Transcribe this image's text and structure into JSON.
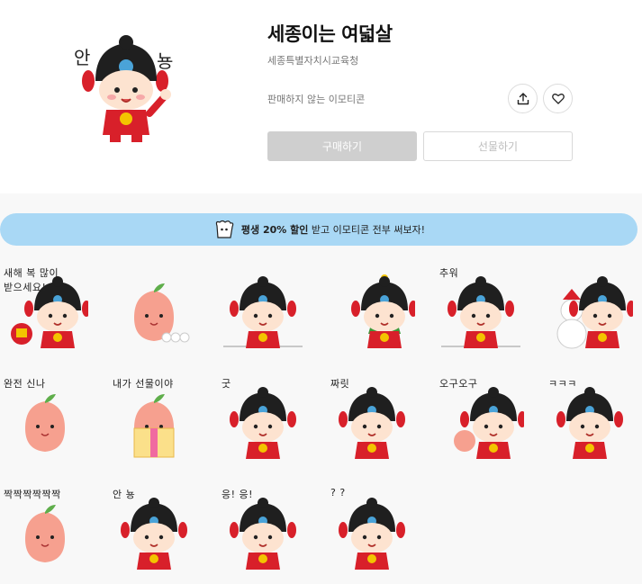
{
  "product": {
    "title": "세종이는 여덟살",
    "author": "세종특별자치시교육청",
    "status": "판매하지 않는 이모티콘",
    "hero_text_left": "안",
    "hero_text_right": "뇽"
  },
  "actions": {
    "share_icon": "share-icon",
    "like_icon": "heart-icon",
    "buy_label": "구매하기",
    "gift_label": "선물하기"
  },
  "banner": {
    "bold": "평생 20% 할인",
    "rest": " 받고 이모티콘 전부 써보자!"
  },
  "stickers": [
    {
      "caption": "새해 복 많이\n받으세요!",
      "kind": "boy-gift"
    },
    {
      "caption": "",
      "kind": "peach-snow"
    },
    {
      "caption": "",
      "kind": "boy-snow"
    },
    {
      "caption": "",
      "kind": "boy-tree"
    },
    {
      "caption": "추워",
      "kind": "boy-cold"
    },
    {
      "caption": "",
      "kind": "boy-snowman"
    },
    {
      "caption": "완전 신나",
      "kind": "peach-dance"
    },
    {
      "caption": "내가 선물이야",
      "kind": "peach-giftbox"
    },
    {
      "caption": "굿",
      "kind": "boy-thumb"
    },
    {
      "caption": "짜릿",
      "kind": "boy-shock"
    },
    {
      "caption": "오구오구",
      "kind": "boy-hug"
    },
    {
      "caption": "ㅋㅋㅋ",
      "kind": "boy-laugh"
    },
    {
      "caption": "짝짝짝짝짝짝",
      "kind": "peach-clap"
    },
    {
      "caption": "안 뇽",
      "kind": "boy-wave"
    },
    {
      "caption": "응! 응!",
      "kind": "boy-nod"
    },
    {
      "caption": "? ?",
      "kind": "boy-question"
    }
  ],
  "colors": {
    "banner_bg": "#a9d8f5",
    "buy_bg": "#cfcfcf",
    "hat": "#1f1f1f",
    "body_red": "#d8202a",
    "peach": "#f6a08f"
  }
}
